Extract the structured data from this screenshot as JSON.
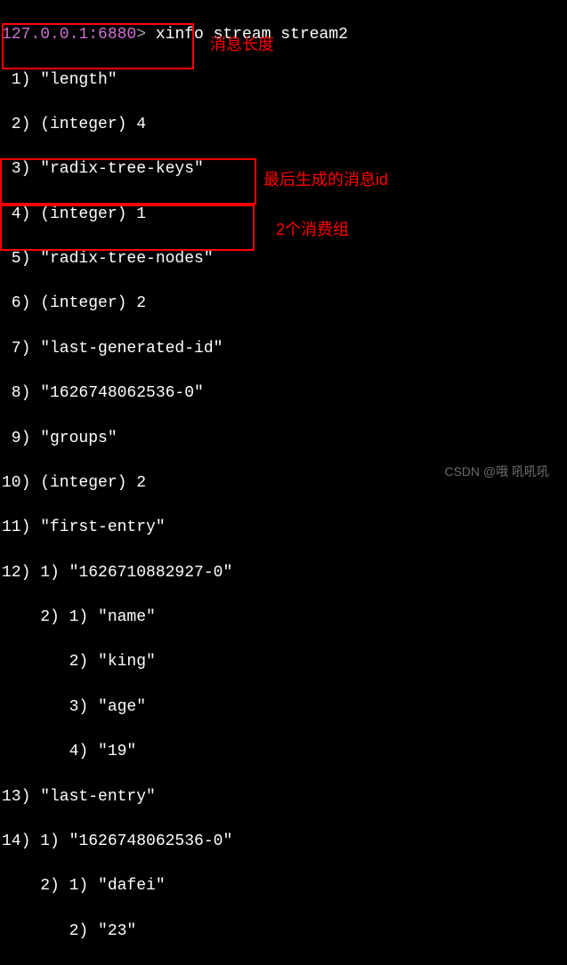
{
  "prompt": {
    "host": "127.0.0.1:6880",
    "sep": "> ",
    "command": "xinfo stream stream2"
  },
  "lines": {
    "l1": " 1) \"length\"",
    "l2": " 2) (integer) 4",
    "l3": " 3) \"radix-tree-keys\"",
    "l4": " 4) (integer) 1",
    "l5": " 5) \"radix-tree-nodes\"",
    "l6": " 6) (integer) 2",
    "l7": " 7) \"last-generated-id\"",
    "l8": " 8) \"1626748062536-0\"",
    "l9": " 9) \"groups\"",
    "l10": "10) (integer) 2",
    "l11": "11) \"first-entry\"",
    "l12": "12) 1) \"1626710882927-0\"",
    "l13": "    2) 1) \"name\"",
    "l14": "       2) \"king\"",
    "l15": "       3) \"age\"",
    "l16": "       4) \"19\"",
    "l17": "13) \"last-entry\"",
    "l18": "14) 1) \"1626748062536-0\"",
    "l19": "    2) 1) \"dafei\"",
    "l20": "       2) \"23\""
  },
  "annotations": {
    "a1": "消息长度",
    "a2": "最后生成的消息id",
    "a3": "2个消费组"
  },
  "watermark": "CSDN @哦    吼吼吼"
}
